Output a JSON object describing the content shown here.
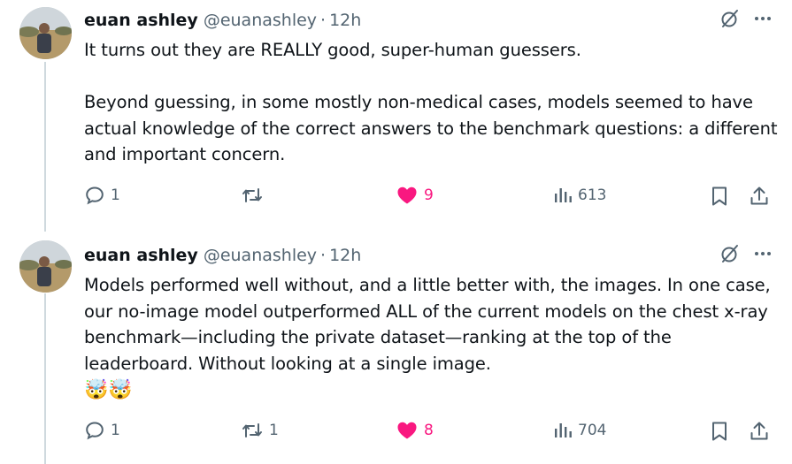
{
  "tweets": [
    {
      "author": {
        "name": "euan ashley",
        "handle": "@euanashley",
        "separator": "·",
        "time": "12h"
      },
      "body": [
        "It turns out they are REALLY good, super-human guessers.",
        "Beyond guessing, in some mostly non-medical cases, models seemed to have actual knowledge of the correct answers to the benchmark questions: a different and important concern."
      ],
      "icons": {
        "grok": "grok-icon",
        "more": "more-icon"
      },
      "actions": {
        "replies": "1",
        "reposts": "",
        "likes": "9",
        "views": "613"
      }
    },
    {
      "author": {
        "name": "euan ashley",
        "handle": "@euanashley",
        "separator": "·",
        "time": "12h"
      },
      "body": [
        "Models performed well without, and a little better with, the images. In one case, our no-image model outperformed ALL of the current models on the chest x-ray benchmark—including the private dataset—ranking at the top of the leaderboard. Without looking at a single image.",
        "🤯🤯"
      ],
      "icons": {
        "grok": "grok-icon",
        "more": "more-icon"
      },
      "actions": {
        "replies": "1",
        "reposts": "1",
        "likes": "8",
        "views": "704"
      }
    }
  ],
  "colors": {
    "text": "#0f1419",
    "secondary": "#536471",
    "like": "#f91880",
    "thread_line": "#cfd9de"
  }
}
